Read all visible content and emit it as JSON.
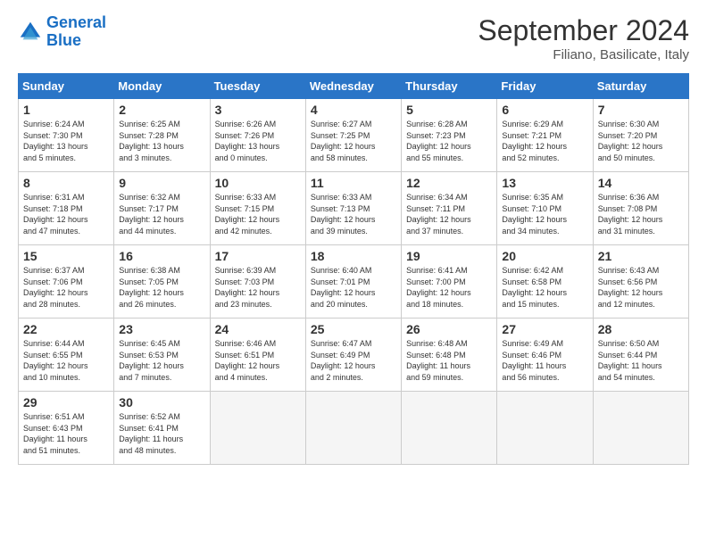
{
  "header": {
    "logo_line1": "General",
    "logo_line2": "Blue",
    "month": "September 2024",
    "location": "Filiano, Basilicate, Italy"
  },
  "weekdays": [
    "Sunday",
    "Monday",
    "Tuesday",
    "Wednesday",
    "Thursday",
    "Friday",
    "Saturday"
  ],
  "days": [
    {
      "num": "",
      "detail": ""
    },
    {
      "num": "",
      "detail": ""
    },
    {
      "num": "",
      "detail": ""
    },
    {
      "num": "",
      "detail": ""
    },
    {
      "num": "",
      "detail": ""
    },
    {
      "num": "",
      "detail": ""
    },
    {
      "num": "7",
      "detail": "Sunrise: 6:30 AM\nSunset: 7:20 PM\nDaylight: 12 hours\nand 50 minutes."
    },
    {
      "num": "8",
      "detail": "Sunrise: 6:31 AM\nSunset: 7:18 PM\nDaylight: 12 hours\nand 47 minutes."
    },
    {
      "num": "9",
      "detail": "Sunrise: 6:32 AM\nSunset: 7:17 PM\nDaylight: 12 hours\nand 44 minutes."
    },
    {
      "num": "10",
      "detail": "Sunrise: 6:33 AM\nSunset: 7:15 PM\nDaylight: 12 hours\nand 42 minutes."
    },
    {
      "num": "11",
      "detail": "Sunrise: 6:33 AM\nSunset: 7:13 PM\nDaylight: 12 hours\nand 39 minutes."
    },
    {
      "num": "12",
      "detail": "Sunrise: 6:34 AM\nSunset: 7:11 PM\nDaylight: 12 hours\nand 37 minutes."
    },
    {
      "num": "13",
      "detail": "Sunrise: 6:35 AM\nSunset: 7:10 PM\nDaylight: 12 hours\nand 34 minutes."
    },
    {
      "num": "14",
      "detail": "Sunrise: 6:36 AM\nSunset: 7:08 PM\nDaylight: 12 hours\nand 31 minutes."
    },
    {
      "num": "15",
      "detail": "Sunrise: 6:37 AM\nSunset: 7:06 PM\nDaylight: 12 hours\nand 28 minutes."
    },
    {
      "num": "16",
      "detail": "Sunrise: 6:38 AM\nSunset: 7:05 PM\nDaylight: 12 hours\nand 26 minutes."
    },
    {
      "num": "17",
      "detail": "Sunrise: 6:39 AM\nSunset: 7:03 PM\nDaylight: 12 hours\nand 23 minutes."
    },
    {
      "num": "18",
      "detail": "Sunrise: 6:40 AM\nSunset: 7:01 PM\nDaylight: 12 hours\nand 20 minutes."
    },
    {
      "num": "19",
      "detail": "Sunrise: 6:41 AM\nSunset: 7:00 PM\nDaylight: 12 hours\nand 18 minutes."
    },
    {
      "num": "20",
      "detail": "Sunrise: 6:42 AM\nSunset: 6:58 PM\nDaylight: 12 hours\nand 15 minutes."
    },
    {
      "num": "21",
      "detail": "Sunrise: 6:43 AM\nSunset: 6:56 PM\nDaylight: 12 hours\nand 12 minutes."
    },
    {
      "num": "22",
      "detail": "Sunrise: 6:44 AM\nSunset: 6:55 PM\nDaylight: 12 hours\nand 10 minutes."
    },
    {
      "num": "23",
      "detail": "Sunrise: 6:45 AM\nSunset: 6:53 PM\nDaylight: 12 hours\nand 7 minutes."
    },
    {
      "num": "24",
      "detail": "Sunrise: 6:46 AM\nSunset: 6:51 PM\nDaylight: 12 hours\nand 4 minutes."
    },
    {
      "num": "25",
      "detail": "Sunrise: 6:47 AM\nSunset: 6:49 PM\nDaylight: 12 hours\nand 2 minutes."
    },
    {
      "num": "26",
      "detail": "Sunrise: 6:48 AM\nSunset: 6:48 PM\nDaylight: 11 hours\nand 59 minutes."
    },
    {
      "num": "27",
      "detail": "Sunrise: 6:49 AM\nSunset: 6:46 PM\nDaylight: 11 hours\nand 56 minutes."
    },
    {
      "num": "28",
      "detail": "Sunrise: 6:50 AM\nSunset: 6:44 PM\nDaylight: 11 hours\nand 54 minutes."
    },
    {
      "num": "29",
      "detail": "Sunrise: 6:51 AM\nSunset: 6:43 PM\nDaylight: 11 hours\nand 51 minutes."
    },
    {
      "num": "30",
      "detail": "Sunrise: 6:52 AM\nSunset: 6:41 PM\nDaylight: 11 hours\nand 48 minutes."
    },
    {
      "num": "",
      "detail": ""
    },
    {
      "num": "",
      "detail": ""
    },
    {
      "num": "",
      "detail": ""
    },
    {
      "num": "",
      "detail": ""
    },
    {
      "num": "",
      "detail": ""
    }
  ],
  "week1": [
    {
      "num": "1",
      "detail": "Sunrise: 6:24 AM\nSunset: 7:30 PM\nDaylight: 13 hours\nand 5 minutes."
    },
    {
      "num": "2",
      "detail": "Sunrise: 6:25 AM\nSunset: 7:28 PM\nDaylight: 13 hours\nand 3 minutes."
    },
    {
      "num": "3",
      "detail": "Sunrise: 6:26 AM\nSunset: 7:26 PM\nDaylight: 13 hours\nand 0 minutes."
    },
    {
      "num": "4",
      "detail": "Sunrise: 6:27 AM\nSunset: 7:25 PM\nDaylight: 12 hours\nand 58 minutes."
    },
    {
      "num": "5",
      "detail": "Sunrise: 6:28 AM\nSunset: 7:23 PM\nDaylight: 12 hours\nand 55 minutes."
    },
    {
      "num": "6",
      "detail": "Sunrise: 6:29 AM\nSunset: 7:21 PM\nDaylight: 12 hours\nand 52 minutes."
    },
    {
      "num": "7",
      "detail": "Sunrise: 6:30 AM\nSunset: 7:20 PM\nDaylight: 12 hours\nand 50 minutes."
    }
  ]
}
